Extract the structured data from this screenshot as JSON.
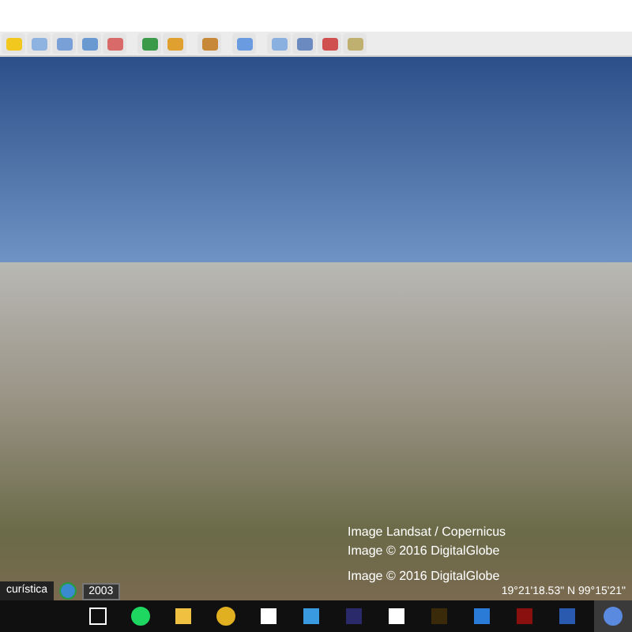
{
  "map_view": {
    "attributions": [
      "Image Landsat / Copernicus",
      "Image © 2016 DigitalGlobe",
      "Image © 2016 DigitalGlobe"
    ]
  },
  "status_bar": {
    "tour_label": "curística",
    "year": "2003",
    "coordinates": "19°21'18.53\" N  99°15'21\""
  }
}
